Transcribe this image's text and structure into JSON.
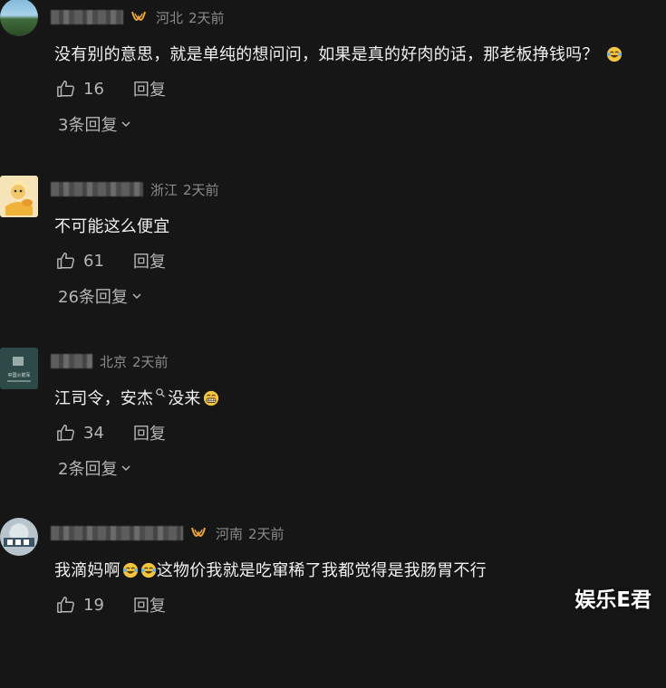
{
  "comments": [
    {
      "location": "河北",
      "time": "2天前",
      "text": "没有别的意思，就是单纯的想问问，如果是真的好肉的话，那老板挣钱吗？",
      "trailing_emoji": "laugh-cry-icon",
      "likes": "16",
      "reply_label": "回复",
      "replies_label": "3条回复"
    },
    {
      "location": "浙江",
      "time": "2天前",
      "text": "不可能这么便宜",
      "likes": "61",
      "reply_label": "回复",
      "replies_label": "26条回复"
    },
    {
      "location": "北京",
      "time": "2天前",
      "text_part1": "江司令，安杰",
      "text_part2": "没来",
      "avatar_text": "中国火箭军",
      "likes": "34",
      "reply_label": "回复",
      "replies_label": "2条回复"
    },
    {
      "location": "河南",
      "time": "2天前",
      "text_part1": "我滴妈啊",
      "text_part2": "这物价我就是吃窜稀了我都觉得是我肠胃不行",
      "likes": "19",
      "reply_label": "回复"
    }
  ],
  "watermark": "娱乐E君",
  "colors": {
    "background": "#161616",
    "text": "#f0f0f0",
    "muted": "#8b8b8b",
    "badge": "#e8a33a"
  }
}
